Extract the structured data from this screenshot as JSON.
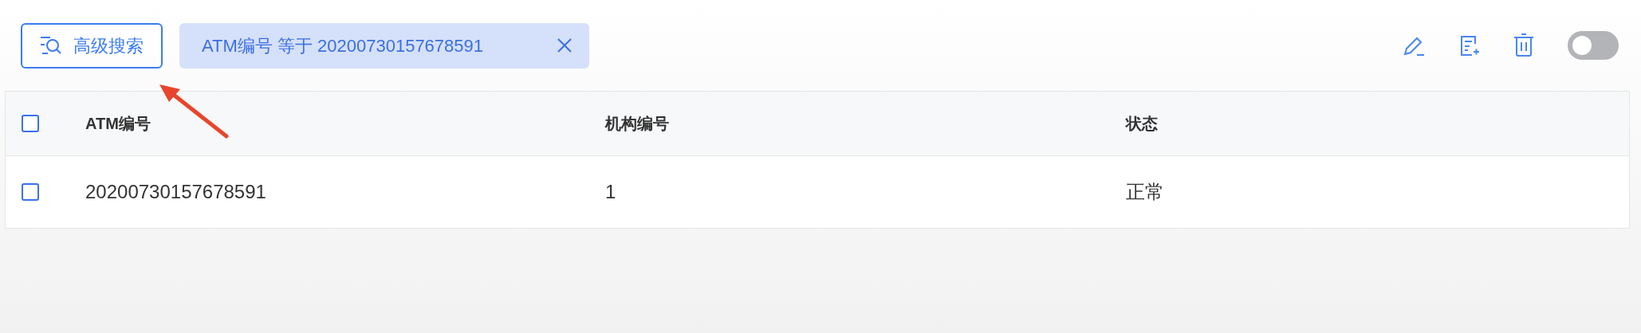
{
  "toolbar": {
    "advanced_search": "高级搜索",
    "filter_tag": "ATM编号 等于 20200730157678591",
    "toggle": {
      "on": false
    }
  },
  "table": {
    "header_checkbox": {
      "checked": false
    },
    "columns": [
      "ATM编号",
      "机构编号",
      "状态"
    ],
    "rows": [
      {
        "checked": false,
        "cells": [
          "20200730157678591",
          "1",
          "正常"
        ]
      }
    ]
  }
}
